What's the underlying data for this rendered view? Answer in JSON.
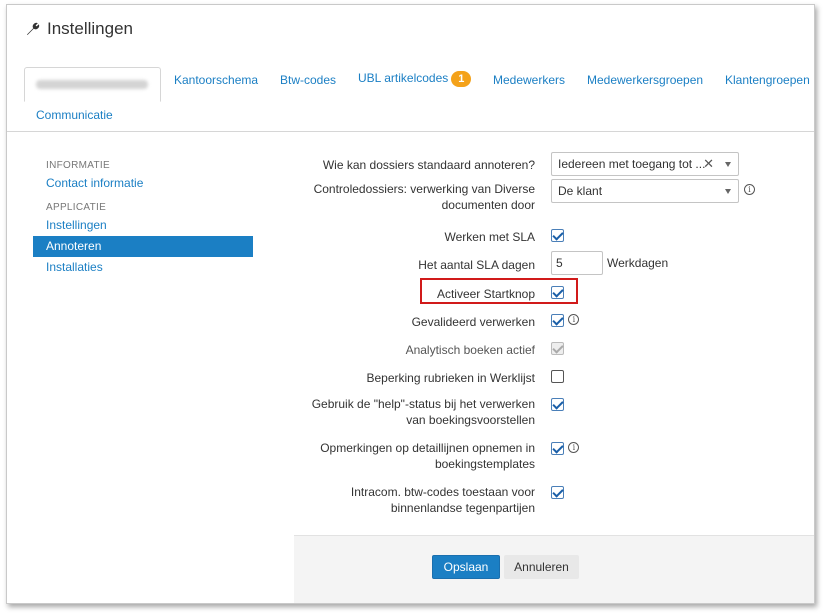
{
  "page": {
    "title": "Instellingen",
    "header_icon": "wrench-icon"
  },
  "tabs": [
    {
      "label": "",
      "blurred": true
    },
    {
      "label": "Kantoorschema"
    },
    {
      "label": "Btw-codes"
    },
    {
      "label": "UBL artikelcodes",
      "badge": "1"
    },
    {
      "label": "Medewerkers"
    },
    {
      "label": "Medewerkersgroepen"
    },
    {
      "label": "Klantengroepen"
    },
    {
      "label": "Communicatie"
    }
  ],
  "sidebar": {
    "sections": [
      {
        "title": "INFORMATIE",
        "items": [
          {
            "label": "Contact informatie"
          }
        ]
      },
      {
        "title": "APPLICATIE",
        "items": [
          {
            "label": "Instellingen"
          },
          {
            "label": "Annoteren",
            "active": true
          },
          {
            "label": "Installaties"
          }
        ]
      }
    ]
  },
  "form": {
    "annotate_default": {
      "label": "Wie kan dossiers standaard annoteren?",
      "value": "Iedereen met toegang tot ..."
    },
    "control_dossiers": {
      "label": "Controledossiers: verwerking van Diverse documenten door",
      "value": "De klant"
    },
    "sla": {
      "label": "Werken met SLA",
      "checked": true
    },
    "sla_days": {
      "label": "Het aantal SLA dagen",
      "value": "5",
      "unit": "Werkdagen"
    },
    "startknop": {
      "label": "Activeer Startknop",
      "checked": true
    },
    "gevalideerd": {
      "label": "Gevalideerd verwerken",
      "checked": true
    },
    "analytisch": {
      "label": "Analytisch boeken actief",
      "checked": true,
      "disabled": true
    },
    "beperking": {
      "label": "Beperking rubrieken in Werklijst",
      "checked": false
    },
    "help_status": {
      "label": "Gebruik de \"help\"-status bij het verwerken van boekingsvoorstellen",
      "checked": true
    },
    "opmerkingen": {
      "label": "Opmerkingen op detaillijnen opnemen in boekingstemplates",
      "checked": true
    },
    "intracom": {
      "label": "Intracom. btw-codes toestaan voor binnenlandse tegenpartijen",
      "checked": true
    }
  },
  "footer": {
    "save_label": "Opslaan",
    "cancel_label": "Annuleren"
  },
  "colors": {
    "accent": "#1b7fc4",
    "badge": "#f4a21a",
    "highlight": "#d11a1a"
  }
}
